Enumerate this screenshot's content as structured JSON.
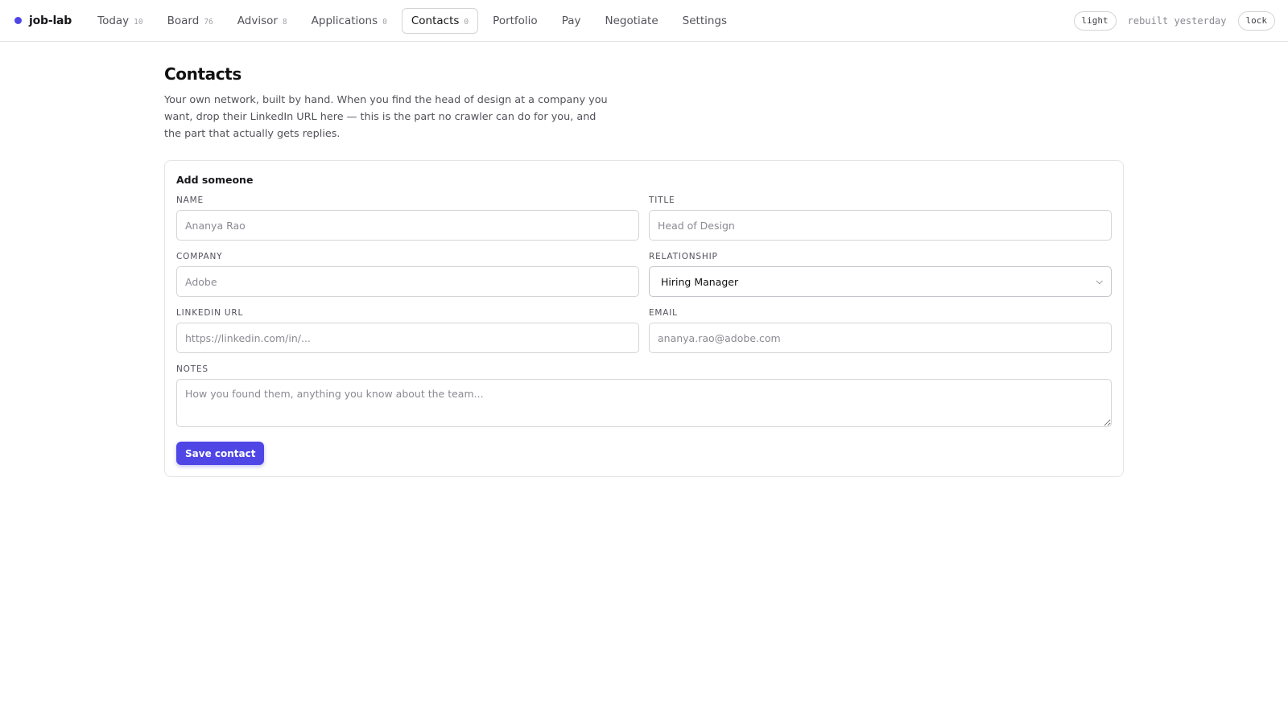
{
  "app": {
    "name": "job-lab",
    "accent": "#4f46e5"
  },
  "nav": [
    {
      "label": "Today",
      "count": "10"
    },
    {
      "label": "Board",
      "count": "76"
    },
    {
      "label": "Advisor",
      "count": "8"
    },
    {
      "label": "Applications",
      "count": "0"
    },
    {
      "label": "Contacts",
      "count": "0",
      "active": true
    },
    {
      "label": "Portfolio"
    },
    {
      "label": "Pay"
    },
    {
      "label": "Negotiate"
    },
    {
      "label": "Settings"
    }
  ],
  "topbar": {
    "theme_label": "light",
    "status": "rebuilt yesterday",
    "lock_label": "lock"
  },
  "page": {
    "title": "Contacts",
    "description": "Your own network, built by hand. When you find the head of design at a company you want, drop their LinkedIn URL here — this is the part no crawler can do for you, and the part that actually gets replies."
  },
  "form": {
    "title": "Add someone",
    "name": {
      "label": "NAME",
      "placeholder": "Ananya Rao"
    },
    "title_field": {
      "label": "TITLE",
      "placeholder": "Head of Design"
    },
    "company": {
      "label": "COMPANY",
      "placeholder": "Adobe"
    },
    "relationship": {
      "label": "RELATIONSHIP",
      "value": "Hiring Manager"
    },
    "linkedin": {
      "label": "LINKEDIN URL",
      "placeholder": "https://linkedin.com/in/..."
    },
    "email": {
      "label": "EMAIL",
      "placeholder": "ananya.rao@adobe.com"
    },
    "notes": {
      "label": "NOTES",
      "placeholder": "How you found them, anything you know about the team..."
    },
    "save_label": "Save contact"
  }
}
